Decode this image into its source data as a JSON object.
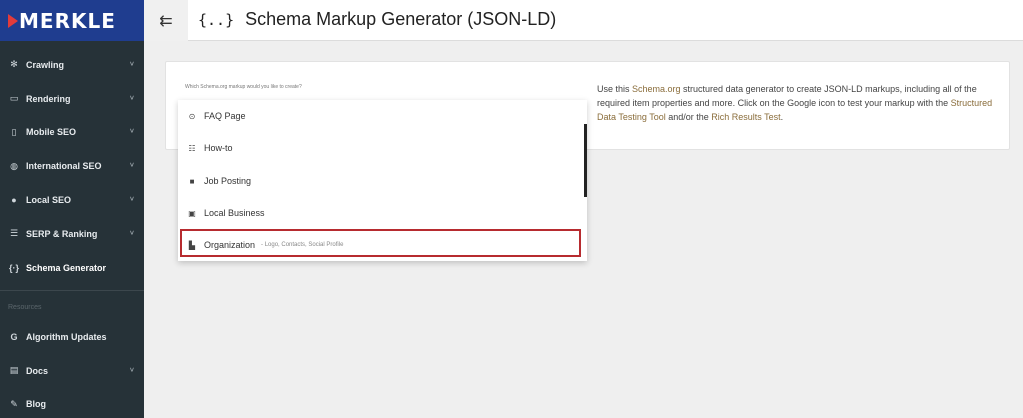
{
  "brand": {
    "name": "MERKLE"
  },
  "sidebar": {
    "items": [
      {
        "label": "Crawling",
        "icon": "bug-icon",
        "glyph": "✻",
        "chevron": "˅"
      },
      {
        "label": "Rendering",
        "icon": "monitor-icon",
        "glyph": "▭",
        "chevron": "˅"
      },
      {
        "label": "Mobile SEO",
        "icon": "phone-icon",
        "glyph": "▯",
        "chevron": "˅"
      },
      {
        "label": "International SEO",
        "icon": "globe-icon",
        "glyph": "◍",
        "chevron": "˅"
      },
      {
        "label": "Local SEO",
        "icon": "pin-icon",
        "glyph": "●",
        "chevron": "˅"
      },
      {
        "label": "SERP & Ranking",
        "icon": "list-icon",
        "glyph": "☰",
        "chevron": "˅"
      },
      {
        "label": "Schema Generator",
        "icon": "braces-icon",
        "glyph": "{·}",
        "chevron": ""
      }
    ],
    "section_label": "Resources",
    "resource_items": [
      {
        "label": "Algorithm Updates",
        "icon": "google-icon",
        "glyph": "G",
        "chevron": ""
      },
      {
        "label": "Docs",
        "icon": "docs-icon",
        "glyph": "▤",
        "chevron": "˅"
      },
      {
        "label": "Blog",
        "icon": "pencil-icon",
        "glyph": "✎",
        "chevron": ""
      }
    ]
  },
  "header": {
    "menu_glyph": "⇇",
    "title_icon": "{..}",
    "title": "Schema Markup Generator (JSON-LD)"
  },
  "main": {
    "question": "Which Schema.org markup would you like to create?",
    "info": {
      "p1": "Use this ",
      "link1": "Schema.org",
      "p2": " structured data generator to create JSON-LD markups, including all of the required item properties and more. Click on the Google icon to test your markup with the ",
      "link2": "Structured Data Testing Tool",
      "p3": " and/or the ",
      "link3": "Rich Results Test",
      "p4": "."
    },
    "dropdown": {
      "options": [
        {
          "label": "FAQ Page",
          "icon": "question-circle-icon",
          "glyph": "⊙",
          "note": ""
        },
        {
          "label": "How-to",
          "icon": "list-icon",
          "glyph": "☷",
          "note": ""
        },
        {
          "label": "Job Posting",
          "icon": "briefcase-icon",
          "glyph": "■",
          "note": ""
        },
        {
          "label": "Local Business",
          "icon": "store-icon",
          "glyph": "▣",
          "note": ""
        },
        {
          "label": "Organization",
          "icon": "building-icon",
          "glyph": "▙",
          "note": "- Logo, Contacts, Social Profile"
        }
      ]
    }
  }
}
